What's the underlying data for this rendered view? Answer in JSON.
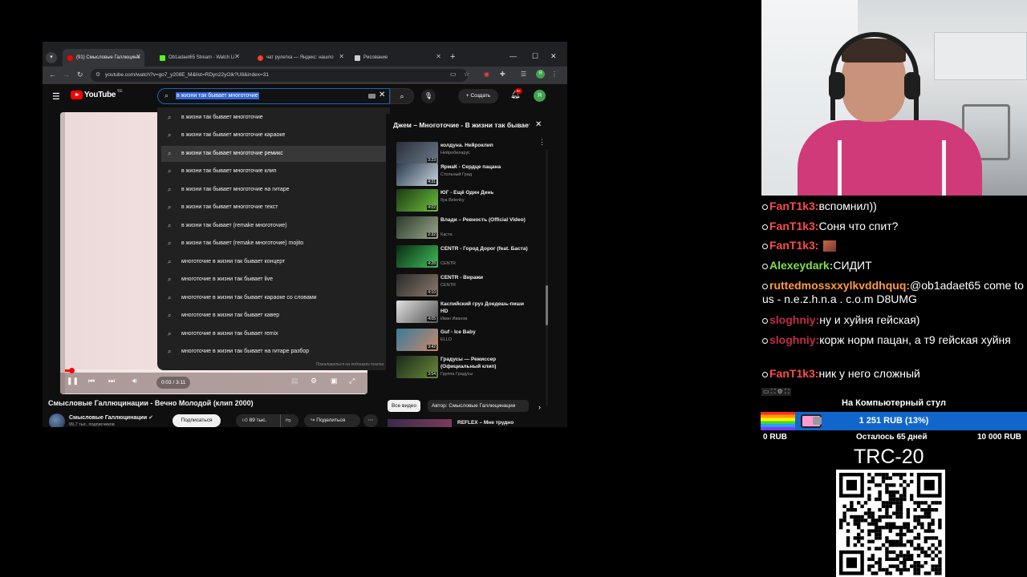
{
  "browser": {
    "tabs": [
      {
        "label": "(91) Смысловые Галлюцина",
        "active": true,
        "favicon_color": "#ff0000"
      },
      {
        "label": "Ob1adaet65 Stream - Watch Li",
        "active": false,
        "favicon_color": "#53fc18"
      },
      {
        "label": "чат рулетка — Яндекс: нашло",
        "active": false,
        "favicon_color": "#fc3f1d"
      },
      {
        "label": "Рисование",
        "active": false,
        "favicon_color": "#cfcfcf"
      }
    ],
    "url": "youtube.com/watch?v=go7_y208E_M&list=RDyn22yOik?U8&index=31",
    "profile_letter": "Я"
  },
  "youtube": {
    "logo_text": "YouTube",
    "logo_region": "BE",
    "search_query": "в жизни так бывает многоточие",
    "create_label": "Создать",
    "notif_count": "9+",
    "avatar_letter": "Я",
    "suggestions": [
      "в жизни так бывает многоточие",
      "в жизни так бывает многоточие караоке",
      "в жизни так бывает многоточие ремикс",
      "в жизни так бывает многоточие клип",
      "в жизни так бывает многоточие на гитаре",
      "в жизни так бывает многоточие текст",
      "в жизни так бывает (remake многоточие)",
      "в жизни так бывает (remake многоточие) mojito",
      "многоточие в жизни так бывает концерт",
      "многоточие в жизни так бывает live",
      "многоточие в жизни так бывает караоке со словами",
      "многоточие в жизни так бывает кавер",
      "многоточие в жизни так бывает remix",
      "многоточие в жизни так бывает на гитаре разбор"
    ],
    "suggest_report": "Пожаловаться на подсказки поиска",
    "player": {
      "time": "0:03 / 3:11",
      "progress_fraction": 0.02
    },
    "video_title": "Смысловые Галлюцинации - Вечно Молодой (клип 2000)",
    "channel_name": "Смысловые Галлюцинации",
    "channel_subs": "99,7 тыс. подписчиков",
    "subscribe_label": "Подписаться",
    "likes": "89 тыс.",
    "share_label": "Поделиться",
    "playlist": {
      "title": "Джем – Многоточие - В жизни так бывает",
      "items": [
        {
          "title": "колдуна. Нейроклип",
          "channel": "Нейробеларус",
          "duration": "3:23",
          "colors": [
            "#2a2f3a",
            "#6b7a8a"
          ]
        },
        {
          "title": "ЯрмаК - Сердце пацана",
          "channel": "Стольный Град",
          "duration": "4:31",
          "colors": [
            "#2b3b4b",
            "#c9d6e2"
          ]
        },
        {
          "title": "ЮГ - Ещё Один День",
          "channel": "Ilya Belenky",
          "duration": "4:02",
          "colors": [
            "#1e3a16",
            "#6bbf3a"
          ]
        },
        {
          "title": "Влади – Ревность (Official Video)",
          "channel": "Каста",
          "duration": "2:32",
          "colors": [
            "#2a3a2a",
            "#9aa88a"
          ]
        },
        {
          "title": "CENTR - Город Дорог (feat. Баста)",
          "channel": "CENTR",
          "duration": "4:28",
          "colors": [
            "#0a2a12",
            "#3fbf5a"
          ]
        },
        {
          "title": "CENTR - Виражи",
          "channel": "CENTR",
          "duration": "4:10",
          "colors": [
            "#2a2a2a",
            "#8a7a6a"
          ]
        },
        {
          "title": "Каспийский груз Доедешь-пиши HD",
          "channel": "Иван Иванов",
          "duration": "4:05",
          "colors": [
            "#e0e0e0",
            "#555555"
          ]
        },
        {
          "title": "Guf - Ice Baby",
          "channel": "ELLO",
          "duration": "3:42",
          "colors": [
            "#3a7a9a",
            "#c88a6a"
          ]
        },
        {
          "title": "Градусы — Режиссер (Официальный клип)",
          "channel": "Группа Градусы",
          "duration": "3:54",
          "colors": [
            "#1a2a1a",
            "#6a8a3a"
          ]
        }
      ]
    },
    "chips": [
      "Все видео",
      "Автор: Смысловые Галлюцинации"
    ],
    "related_title": "REFLEX – Мне трудно"
  },
  "chat": {
    "messages": [
      {
        "nick": "FanT1k3:",
        "text": "вспомнил))",
        "nick_color": "#ff4a4a"
      },
      {
        "nick": "FanT1k3:",
        "text": "Соня что спит?",
        "nick_color": "#ff4a4a"
      },
      {
        "nick": "FanT1k3:",
        "text": "",
        "nick_color": "#ff4a4a",
        "emote": true
      },
      {
        "nick": "Alexeydark:",
        "text": "СИДИТ",
        "nick_color": "#7fe04a"
      },
      {
        "nick": "ruttedmossxxylkvddhquq:",
        "text": "@ob1adaet65 come to us - n.e.z.h.n.a . c.o.m D8UMG",
        "nick_color": "#ff9a3c"
      },
      {
        "nick": "sloghniy:",
        "text": "ну и хуйня гейская)",
        "nick_color": "#c02a4a"
      },
      {
        "nick": "sloghniy:",
        "text": "корж норм пацан, а т9 гейская хуйня",
        "nick_color": "#c02a4a"
      },
      {
        "nick": "FanT1k3:",
        "text": "ник у него сложный",
        "nick_color": "#ff4a4a"
      }
    ]
  },
  "donation": {
    "title": "На Компьютерный стул",
    "current": "1 251 RUB (13%)",
    "progress_fraction": 0.13,
    "min": "0 RUB",
    "days_left": "Осталось 65 дней",
    "max": "10 000 RUB",
    "crypto_label": "TRC-20"
  }
}
